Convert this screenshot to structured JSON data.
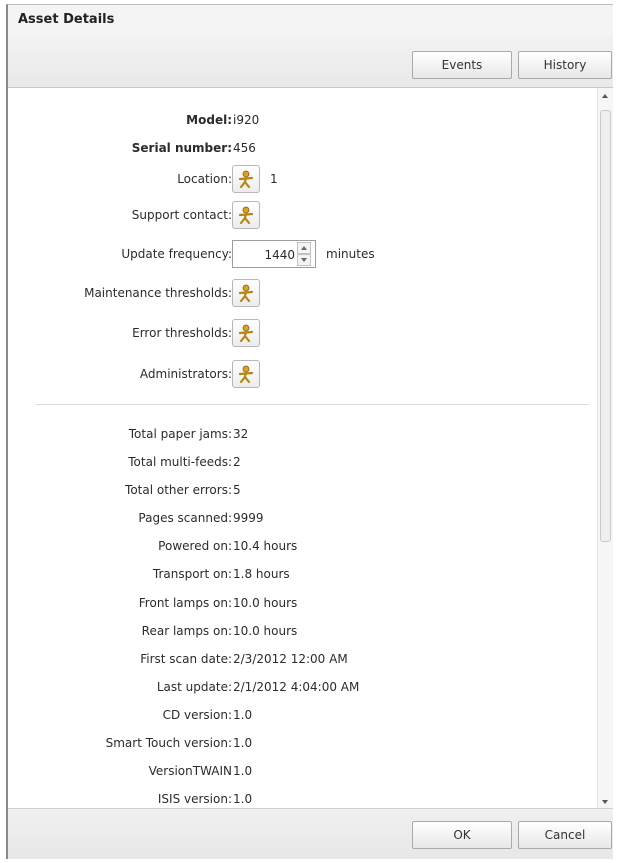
{
  "window": {
    "title": "Asset Details"
  },
  "toolbar": {
    "events_label": "Events",
    "history_label": "History"
  },
  "details": {
    "model_label": "Model:",
    "model_value": "i920",
    "serial_label": "Serial number:",
    "serial_value": "456",
    "location_label": "Location:",
    "location_value": "1",
    "support_label": "Support contact:",
    "update_label": "Update frequency:",
    "update_value": "1440",
    "update_unit": "minutes",
    "maintenance_label": "Maintenance thresholds:",
    "error_label": "Error thresholds:",
    "admins_label": "Administrators:"
  },
  "stats": [
    {
      "label": "Total paper jams:",
      "value": "32"
    },
    {
      "label": "Total multi-feeds:",
      "value": "2"
    },
    {
      "label": "Total other errors:",
      "value": "5"
    },
    {
      "label": "Pages scanned:",
      "value": "9999"
    },
    {
      "label": "Powered on:",
      "value": "10.4 hours"
    },
    {
      "label": "Transport on:",
      "value": "1.8 hours"
    },
    {
      "label": "Front lamps on:",
      "value": "10.0 hours"
    },
    {
      "label": "Rear lamps on:",
      "value": "10.0 hours"
    },
    {
      "label": "First scan date:",
      "value": "2/3/2012 12:00 AM"
    },
    {
      "label": "Last update:",
      "value": "2/1/2012 4:04:00 AM"
    },
    {
      "label": "CD version:",
      "value": "1.0"
    },
    {
      "label": "Smart Touch version:",
      "value": "1.0"
    },
    {
      "label": "VersionTWAIN",
      "value": "1.0"
    },
    {
      "label": "ISIS version:",
      "value": "1.0"
    }
  ],
  "footer": {
    "ok_label": "OK",
    "cancel_label": "Cancel"
  },
  "icons": {
    "person_picker": "person-picker-icon"
  },
  "colors": {
    "icon_gold": "#d9a421",
    "icon_brown": "#8a5a14"
  }
}
